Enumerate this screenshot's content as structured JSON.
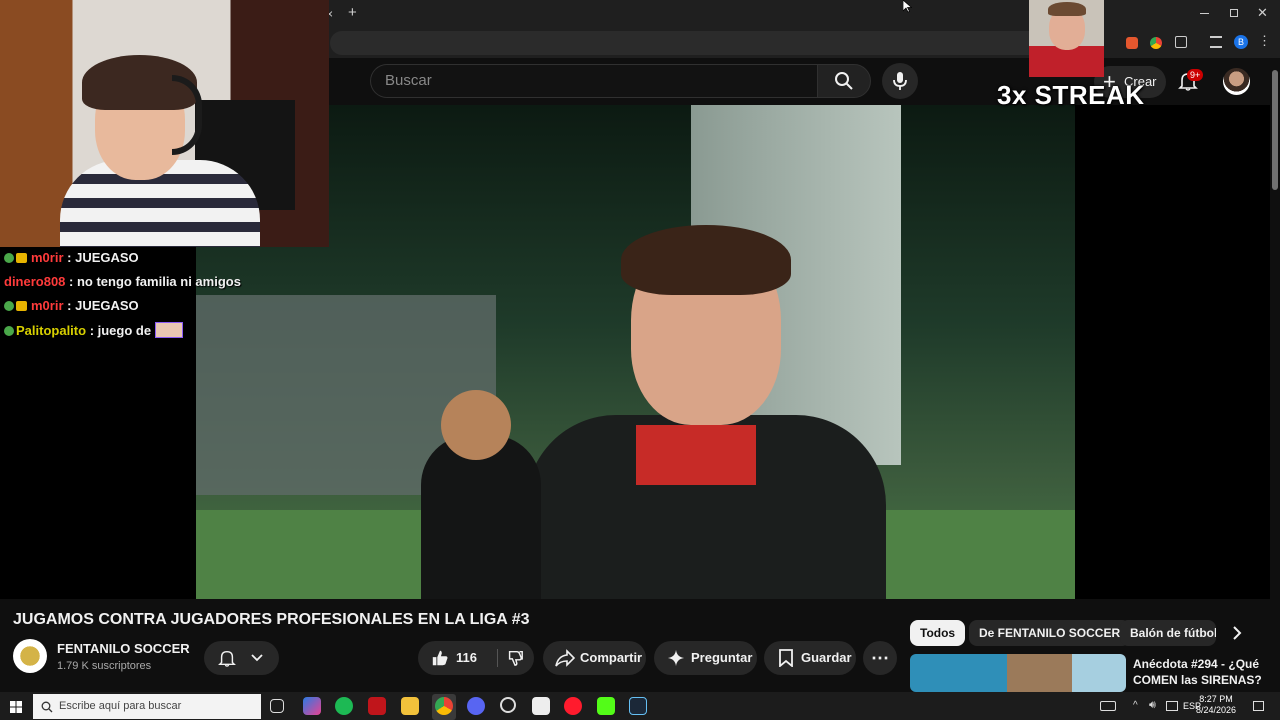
{
  "streak_overlay": "3x STREAK",
  "browser": {
    "close_tab": "×",
    "new_tab": "+",
    "profile_letter": "B"
  },
  "youtube": {
    "search_placeholder": "Buscar",
    "create_label": "Crear",
    "notifications_badge": "9+"
  },
  "chat": [
    {
      "user": "m0rir",
      "message": ": JUEGASO",
      "color": "uname-r",
      "badges": true
    },
    {
      "user": "dinero808",
      "message": ": no tengo familia ni amigos",
      "color": "uname-r",
      "badges": false
    },
    {
      "user": "m0rir",
      "message": ": JUEGASO",
      "color": "uname-r",
      "badges": true
    },
    {
      "user": "Palitopalito",
      "message": ": juego de",
      "color": "uname-y",
      "badges": true
    }
  ],
  "video": {
    "title": "JUGAMOS CONTRA JUGADORES PROFESIONALES EN LA LIGA #3",
    "channel_name": "FENTANILO SOCCER",
    "subscribers": "1.79 K suscriptores",
    "likes": "116",
    "share_label": "Compartir",
    "ask_label": "Preguntar",
    "save_label": "Guardar"
  },
  "chips": [
    "Todos",
    "De FENTANILO SOCCER",
    "Balón de fútbol"
  ],
  "recommended": {
    "title": "Anécdota #294  - ¿Qué COMEN las SIRENAS?"
  },
  "taskbar": {
    "search_placeholder": "Escribe aquí para buscar",
    "language": "ESP",
    "time": "8:27 PM",
    "date": "8/24/2026"
  },
  "colors": {
    "accent_red": "#cc0000",
    "background": "#0f0f0f",
    "pill": "#272727"
  }
}
